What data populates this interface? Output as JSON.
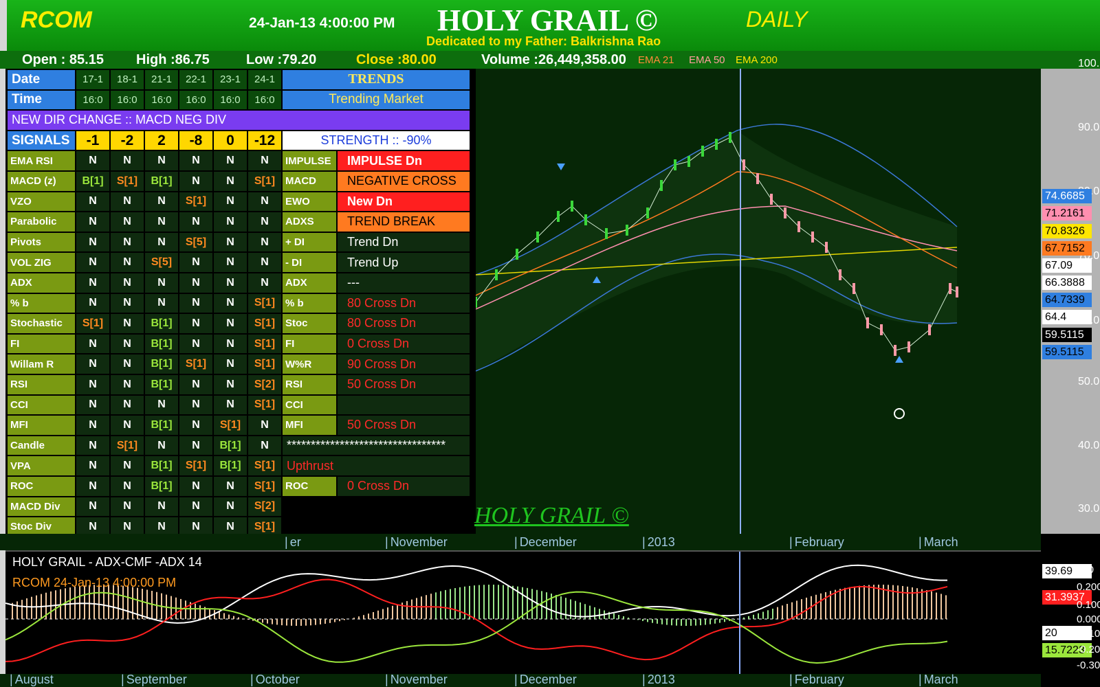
{
  "header": {
    "ticker": "RCOM",
    "datetime": "24-Jan-13 4:00:00 PM",
    "title": "HOLY GRAIL ©",
    "subtitle": "Dedicated to my Father: Balkrishna Rao",
    "period": "DAILY"
  },
  "ohlc": {
    "open": "Open : 85.15",
    "high": "High :86.75",
    "low": "Low :79.20",
    "close": "Close :80.00",
    "volume": "Volume :26,449,358.00",
    "ema21": "EMA 21",
    "ema50": "EMA 50",
    "ema200": "EMA 200"
  },
  "panel": {
    "date_label": "Date",
    "dates": [
      "17-1",
      "18-1",
      "21-1",
      "22-1",
      "23-1",
      "24-1"
    ],
    "time_label": "Time",
    "times": [
      "16:0",
      "16:0",
      "16:0",
      "16:0",
      "16:0",
      "16:0"
    ],
    "trends_label": "TRENDS",
    "trending_market": "Trending Market",
    "dir_change": "NEW DIR CHANGE :: MACD NEG DIV",
    "signals_label": "SIGNALS",
    "signals": [
      "-1",
      "-2",
      "2",
      "-8",
      "0",
      "-12"
    ],
    "strength": "STRENGTH :: -90%",
    "indicators": [
      {
        "name": "EMA RSI",
        "vals": [
          "N",
          "N",
          "N",
          "N",
          "N",
          "N"
        ],
        "rt_label": "IMPULSE",
        "rt_value": "IMPULSE Dn",
        "rt_style": "fill-red"
      },
      {
        "name": "MACD (z)",
        "vals": [
          "B[1]",
          "S[1]",
          "B[1]",
          "N",
          "N",
          "S[1]"
        ],
        "rt_label": "MACD",
        "rt_value": "NEGATIVE CROSS",
        "rt_style": "fill-orange"
      },
      {
        "name": "VZO",
        "vals": [
          "N",
          "N",
          "N",
          "S[1]",
          "N",
          "N"
        ],
        "rt_label": "EWO",
        "rt_value": "New Dn",
        "rt_style": "fill-red"
      },
      {
        "name": "Parabolic",
        "vals": [
          "N",
          "N",
          "N",
          "N",
          "N",
          "N"
        ],
        "rt_label": "ADXS",
        "rt_value": "TREND BREAK",
        "rt_style": "fill-orange"
      },
      {
        "name": "Pivots",
        "vals": [
          "N",
          "N",
          "N",
          "S[5]",
          "N",
          "N"
        ],
        "rt_label": "+ DI",
        "rt_value": "Trend Dn",
        "rt_style": "white"
      },
      {
        "name": "VOL ZIG",
        "vals": [
          "N",
          "N",
          "S[5]",
          "N",
          "N",
          "N"
        ],
        "rt_label": "- DI",
        "rt_value": "Trend Up",
        "rt_style": "white"
      },
      {
        "name": "ADX",
        "vals": [
          "N",
          "N",
          "N",
          "N",
          "N",
          "N"
        ],
        "rt_label": "ADX",
        "rt_value": "---",
        "rt_style": "white"
      },
      {
        "name": "% b",
        "vals": [
          "N",
          "N",
          "N",
          "N",
          "N",
          "S[1]"
        ],
        "rt_label": "% b",
        "rt_value": "80 Cross Dn",
        "rt_style": "red"
      },
      {
        "name": "Stochastic",
        "vals": [
          "S[1]",
          "N",
          "B[1]",
          "N",
          "N",
          "S[1]"
        ],
        "rt_label": "Stoc",
        "rt_value": "80 Cross Dn",
        "rt_style": "red"
      },
      {
        "name": "FI",
        "vals": [
          "N",
          "N",
          "B[1]",
          "N",
          "N",
          "S[1]"
        ],
        "rt_label": "FI",
        "rt_value": "0 Cross Dn",
        "rt_style": "red"
      },
      {
        "name": "Willam R",
        "vals": [
          "N",
          "N",
          "B[1]",
          "S[1]",
          "N",
          "S[1]"
        ],
        "rt_label": "W%R",
        "rt_value": "90 Cross Dn",
        "rt_style": "red"
      },
      {
        "name": "RSI",
        "vals": [
          "N",
          "N",
          "B[1]",
          "N",
          "N",
          "S[2]"
        ],
        "rt_label": "RSI",
        "rt_value": "50 Cross Dn",
        "rt_style": "red"
      },
      {
        "name": "CCI",
        "vals": [
          "N",
          "N",
          "N",
          "N",
          "N",
          "S[1]"
        ],
        "rt_label": "CCI",
        "rt_value": "",
        "rt_style": "white"
      },
      {
        "name": "MFI",
        "vals": [
          "N",
          "N",
          "B[1]",
          "N",
          "S[1]",
          "N"
        ],
        "rt_label": "MFI",
        "rt_value": "50 Cross Dn",
        "rt_style": "red"
      },
      {
        "name": "Candle",
        "vals": [
          "N",
          "S[1]",
          "N",
          "N",
          "B[1]",
          "N"
        ],
        "rt_label": "",
        "rt_value": "*********************************",
        "rt_style": "white"
      },
      {
        "name": "VPA",
        "vals": [
          "N",
          "N",
          "B[1]",
          "S[1]",
          "B[1]",
          "S[1]"
        ],
        "rt_label": "",
        "rt_value": "Upthrust",
        "rt_style": "red"
      },
      {
        "name": "ROC",
        "vals": [
          "N",
          "N",
          "B[1]",
          "N",
          "N",
          "S[1]"
        ],
        "rt_label": "ROC",
        "rt_value": "0 Cross Dn",
        "rt_style": "red"
      },
      {
        "name": "MACD Div",
        "vals": [
          "N",
          "N",
          "N",
          "N",
          "N",
          "S[2]"
        ],
        "rt_label": "",
        "rt_value": "",
        "rt_style": "none"
      },
      {
        "name": "Stoc Div",
        "vals": [
          "N",
          "N",
          "N",
          "N",
          "N",
          "S[1]"
        ],
        "rt_label": "",
        "rt_value": "",
        "rt_style": "none"
      }
    ]
  },
  "chart": {
    "watermark": "HOLY GRAIL ©",
    "x_labels": [
      "er",
      "November",
      "December",
      "2013",
      "February",
      "March"
    ],
    "y_ticks": [
      "100.",
      "90.0",
      "80.0",
      "70.0",
      "60.0",
      "50.0",
      "40.0",
      "30.0"
    ],
    "price_tags": [
      {
        "value": "74.6685",
        "color": "#2f7fe0",
        "text": "#ffffff"
      },
      {
        "value": "71.2161",
        "color": "#ff8fb0",
        "text": "#000000"
      },
      {
        "value": "70.8326",
        "color": "#ffe600",
        "text": "#000000"
      },
      {
        "value": "67.7152",
        "color": "#ff7a20",
        "text": "#000000"
      },
      {
        "value": "67.09",
        "color": "#ffffff",
        "text": "#000000"
      },
      {
        "value": "66.3888",
        "color": "#ffffff",
        "text": "#000000"
      },
      {
        "value": "64.7339",
        "color": "#2f7fe0",
        "text": "#000000"
      },
      {
        "value": "64.4",
        "color": "#ffffff",
        "text": "#000000"
      },
      {
        "value": "59.5115",
        "color": "#000000",
        "text": "#ffffff"
      },
      {
        "value": "59.5115",
        "color": "#2f7fe0",
        "text": "#000000"
      }
    ]
  },
  "lower": {
    "title": "HOLY GRAIL - ADX-CMF -ADX 14",
    "subtitle": "RCOM   24-Jan-13 4:00:00 PM",
    "x_labels": [
      "August",
      "September",
      "October",
      "November",
      "December",
      "2013",
      "February",
      "March"
    ],
    "tags": [
      {
        "value": "39.69",
        "color": "#ffffff",
        "text": "#000000"
      },
      {
        "value": "31.3937",
        "color": "#ff1f1f",
        "text": "#ffffff"
      },
      {
        "value": "20",
        "color": "#ffffff",
        "text": "#000000"
      },
      {
        "value": "15.7223",
        "color": "#9be63c",
        "text": "#000000"
      }
    ],
    "ticks": [
      "300",
      "0.200",
      "0.100",
      "0.000",
      "-0.100",
      "-0.200",
      "-0.300"
    ]
  }
}
